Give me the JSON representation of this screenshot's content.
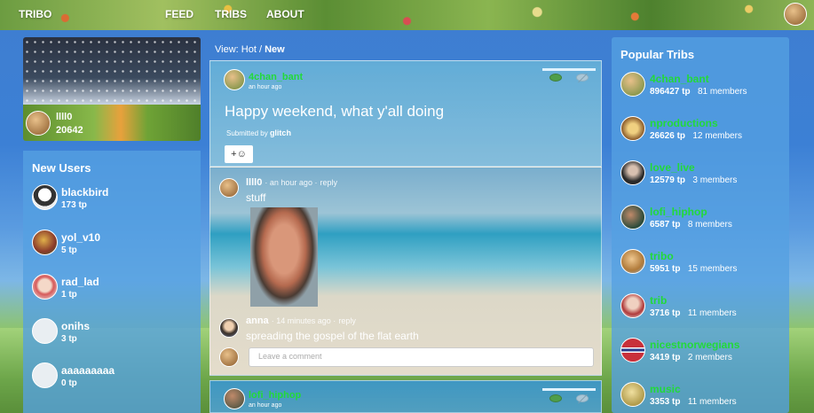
{
  "nav": {
    "brand": "TRIBO",
    "feed": "FEED",
    "tribs": "TRIBS",
    "about": "ABOUT"
  },
  "profile": {
    "name": "llll0",
    "tp": "20642"
  },
  "new_users": {
    "title": "New Users",
    "items": [
      {
        "name": "blackbird",
        "tp": "173 tp"
      },
      {
        "name": "yol_v10",
        "tp": "5 tp"
      },
      {
        "name": "rad_lad",
        "tp": "1 tp"
      },
      {
        "name": "onihs",
        "tp": "3 tp"
      },
      {
        "name": "aaaaaaaaa",
        "tp": "0 tp"
      }
    ]
  },
  "view": {
    "label": "View:",
    "hot": "Hot",
    "sep": "/",
    "new": "New"
  },
  "post": {
    "author": "4chan_bant",
    "time": "an hour ago",
    "title": "Happy weekend, what y'all doing",
    "submitted_label": "Submitted by",
    "submitted_by": "glitch",
    "react_label": "+☺"
  },
  "comments": [
    {
      "author": "llll0",
      "time": "· an hour ago ·",
      "reply": "reply",
      "text": "stuff"
    },
    {
      "author": "anna",
      "time": "· 14 minutes ago ·",
      "reply": "reply",
      "text": "spreading the gospel of the flat earth"
    }
  ],
  "comment_input": {
    "placeholder": "Leave a comment"
  },
  "post2": {
    "author": "lofi_hiphop",
    "time": "an hour ago"
  },
  "popular": {
    "title": "Popular Tribs",
    "items": [
      {
        "name": "4chan_bant",
        "tp": "896427 tp",
        "members": "81 members"
      },
      {
        "name": "nproductions",
        "tp": "26626 tp",
        "members": "12 members"
      },
      {
        "name": "love_live",
        "tp": "12579 tp",
        "members": "3 members"
      },
      {
        "name": "lofi_hiphop",
        "tp": "6587 tp",
        "members": "8 members"
      },
      {
        "name": "tribo",
        "tp": "5951 tp",
        "members": "15 members"
      },
      {
        "name": "trib",
        "tp": "3716 tp",
        "members": "11 members"
      },
      {
        "name": "nicestnorwegians",
        "tp": "3419 tp",
        "members": "2 members"
      },
      {
        "name": "music",
        "tp": "3353 tp",
        "members": "11 members"
      }
    ]
  },
  "colors": {
    "accent_green": "#22d93a",
    "panel_blue": "#55a0e1"
  }
}
